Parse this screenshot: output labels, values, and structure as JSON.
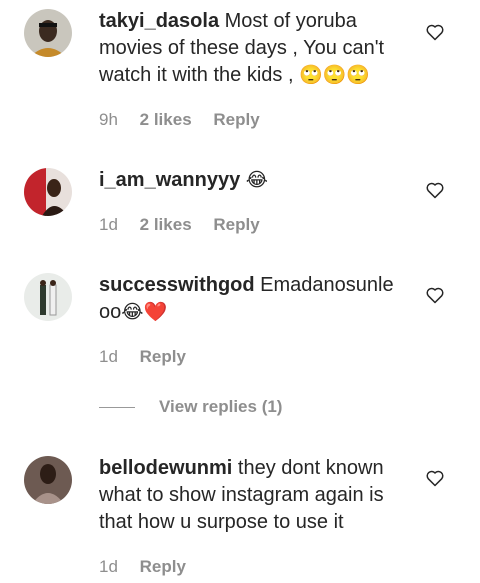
{
  "comments": [
    {
      "username": "takyi_dasola",
      "text": "Most of yoruba movies of these days , You can't watch it with the kids ,",
      "emoji": "🙄🙄🙄",
      "time": "9h",
      "likes": "2 likes",
      "reply": "Reply",
      "avatar_icon": "profile-photo"
    },
    {
      "username": "i_am_wannyyy",
      "text": "",
      "emoji": "😂",
      "time": "1d",
      "likes": "2 likes",
      "reply": "Reply",
      "avatar_icon": "profile-photo"
    },
    {
      "username": "successwithgod",
      "text": "Emadanosunle oo",
      "emoji": "😂❤️",
      "time": "1d",
      "likes": "",
      "reply": "Reply",
      "avatar_icon": "profile-photo"
    },
    {
      "username": "bellodewunmi",
      "text": "they dont known what to show instagram again is that how u surpose to use it",
      "emoji": "",
      "time": "1d",
      "likes": "",
      "reply": "Reply",
      "avatar_icon": "profile-photo"
    }
  ],
  "view_replies": "View replies (1)",
  "icons": {
    "like": "heart-outline-icon"
  },
  "colors": {
    "text": "#262626",
    "secondary": "#8e8e8e"
  }
}
